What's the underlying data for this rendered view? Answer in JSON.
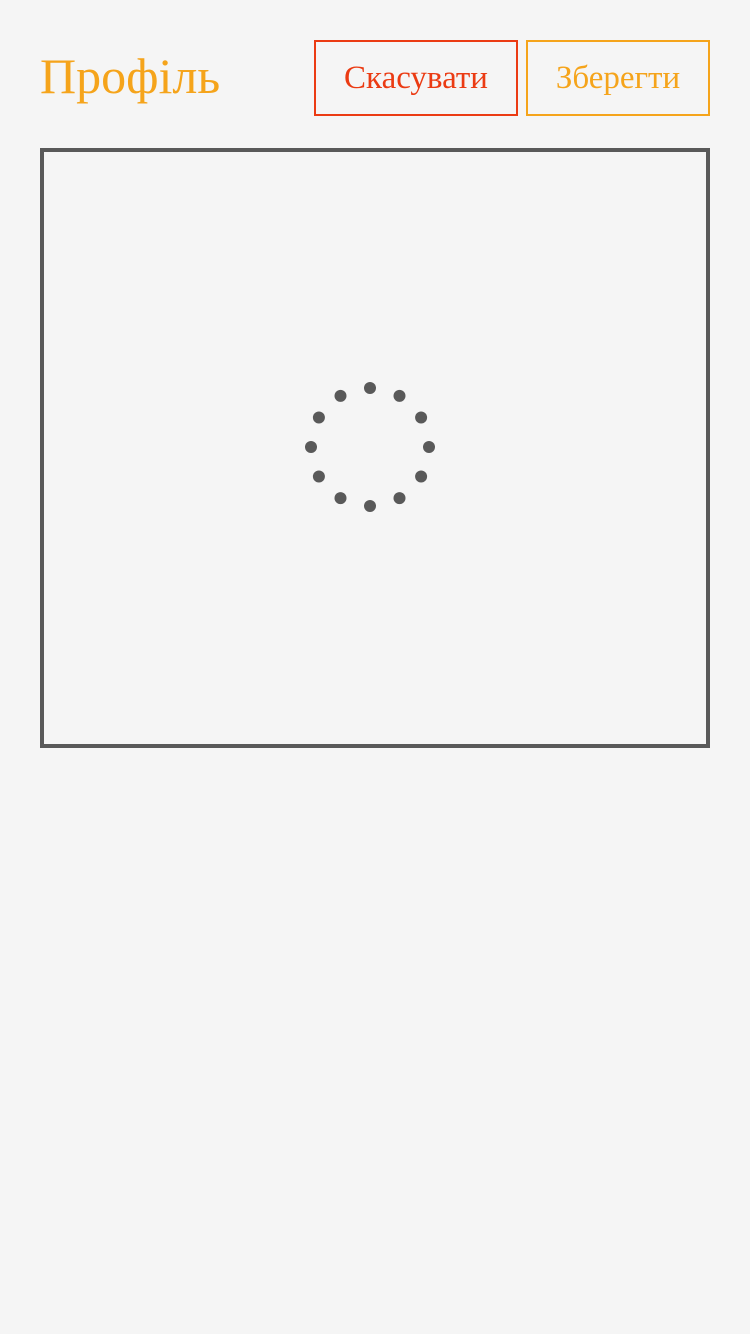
{
  "header": {
    "title": "Профіль",
    "cancel_label": "Скасувати",
    "save_label": "Зберегти"
  },
  "spinner": {
    "icon": "loading-spinner-icon",
    "dot_count": 12,
    "color": "#595959"
  },
  "colors": {
    "accent": "#f5a41b",
    "danger": "#eb3b13",
    "border": "#595959",
    "background": "#f5f5f5"
  }
}
